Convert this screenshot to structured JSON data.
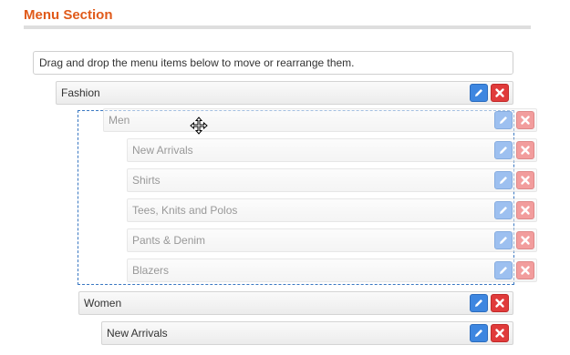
{
  "header": {
    "title": "Menu Section"
  },
  "help_text": "Drag and drop the menu items below to move or rearrange them.",
  "menu": {
    "fashion": "Fashion",
    "men": "Men",
    "men_children": [
      "New Arrivals",
      "Shirts",
      "Tees, Knits and Polos",
      "Pants & Denim",
      "Blazers"
    ],
    "women": "Women",
    "women_children": [
      "New Arrivals"
    ]
  },
  "colors": {
    "title": "#e05a1a",
    "edit_button": "#3d86e0",
    "delete_button": "#e03b3b",
    "drag_outline": "#3a78c2"
  },
  "icons": {
    "edit": "pencil-icon",
    "delete": "close-icon",
    "cursor": "move-cursor-icon"
  }
}
